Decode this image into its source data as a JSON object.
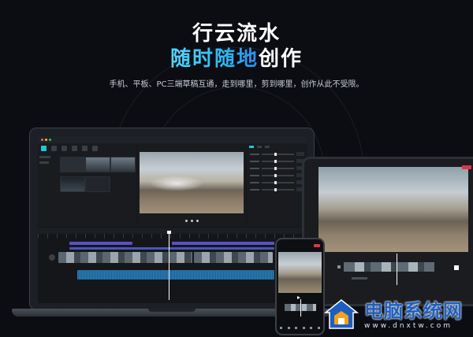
{
  "hero": {
    "line1": "行云流水",
    "line2_highlight": "随时随地",
    "line2_rest": "创作",
    "subtitle": "手机、平板、PC三端草稿互通，走到哪里，剪到哪里，创作从此不受限。"
  },
  "colors": {
    "highlight_start": "#56d6ff",
    "highlight_end": "#2b8cf0",
    "accent": "#1ec7d4",
    "export_red": "#e0344c",
    "watermark_blue": "#1d5fbf"
  },
  "icons": {
    "watermark_logo": "house-shield-icon",
    "play": "play-icon"
  },
  "watermark": {
    "title": "电脑系统网",
    "url": "www.dnxtw.com"
  }
}
